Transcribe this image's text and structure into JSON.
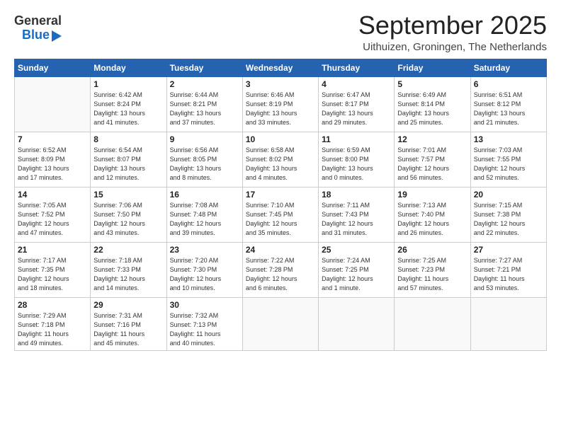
{
  "header": {
    "logo_general": "General",
    "logo_blue": "Blue",
    "month_title": "September 2025",
    "subtitle": "Uithuizen, Groningen, The Netherlands"
  },
  "weekdays": [
    "Sunday",
    "Monday",
    "Tuesday",
    "Wednesday",
    "Thursday",
    "Friday",
    "Saturday"
  ],
  "weeks": [
    [
      {
        "day": "",
        "info": ""
      },
      {
        "day": "1",
        "info": "Sunrise: 6:42 AM\nSunset: 8:24 PM\nDaylight: 13 hours\nand 41 minutes."
      },
      {
        "day": "2",
        "info": "Sunrise: 6:44 AM\nSunset: 8:21 PM\nDaylight: 13 hours\nand 37 minutes."
      },
      {
        "day": "3",
        "info": "Sunrise: 6:46 AM\nSunset: 8:19 PM\nDaylight: 13 hours\nand 33 minutes."
      },
      {
        "day": "4",
        "info": "Sunrise: 6:47 AM\nSunset: 8:17 PM\nDaylight: 13 hours\nand 29 minutes."
      },
      {
        "day": "5",
        "info": "Sunrise: 6:49 AM\nSunset: 8:14 PM\nDaylight: 13 hours\nand 25 minutes."
      },
      {
        "day": "6",
        "info": "Sunrise: 6:51 AM\nSunset: 8:12 PM\nDaylight: 13 hours\nand 21 minutes."
      }
    ],
    [
      {
        "day": "7",
        "info": "Sunrise: 6:52 AM\nSunset: 8:09 PM\nDaylight: 13 hours\nand 17 minutes."
      },
      {
        "day": "8",
        "info": "Sunrise: 6:54 AM\nSunset: 8:07 PM\nDaylight: 13 hours\nand 12 minutes."
      },
      {
        "day": "9",
        "info": "Sunrise: 6:56 AM\nSunset: 8:05 PM\nDaylight: 13 hours\nand 8 minutes."
      },
      {
        "day": "10",
        "info": "Sunrise: 6:58 AM\nSunset: 8:02 PM\nDaylight: 13 hours\nand 4 minutes."
      },
      {
        "day": "11",
        "info": "Sunrise: 6:59 AM\nSunset: 8:00 PM\nDaylight: 13 hours\nand 0 minutes."
      },
      {
        "day": "12",
        "info": "Sunrise: 7:01 AM\nSunset: 7:57 PM\nDaylight: 12 hours\nand 56 minutes."
      },
      {
        "day": "13",
        "info": "Sunrise: 7:03 AM\nSunset: 7:55 PM\nDaylight: 12 hours\nand 52 minutes."
      }
    ],
    [
      {
        "day": "14",
        "info": "Sunrise: 7:05 AM\nSunset: 7:52 PM\nDaylight: 12 hours\nand 47 minutes."
      },
      {
        "day": "15",
        "info": "Sunrise: 7:06 AM\nSunset: 7:50 PM\nDaylight: 12 hours\nand 43 minutes."
      },
      {
        "day": "16",
        "info": "Sunrise: 7:08 AM\nSunset: 7:48 PM\nDaylight: 12 hours\nand 39 minutes."
      },
      {
        "day": "17",
        "info": "Sunrise: 7:10 AM\nSunset: 7:45 PM\nDaylight: 12 hours\nand 35 minutes."
      },
      {
        "day": "18",
        "info": "Sunrise: 7:11 AM\nSunset: 7:43 PM\nDaylight: 12 hours\nand 31 minutes."
      },
      {
        "day": "19",
        "info": "Sunrise: 7:13 AM\nSunset: 7:40 PM\nDaylight: 12 hours\nand 26 minutes."
      },
      {
        "day": "20",
        "info": "Sunrise: 7:15 AM\nSunset: 7:38 PM\nDaylight: 12 hours\nand 22 minutes."
      }
    ],
    [
      {
        "day": "21",
        "info": "Sunrise: 7:17 AM\nSunset: 7:35 PM\nDaylight: 12 hours\nand 18 minutes."
      },
      {
        "day": "22",
        "info": "Sunrise: 7:18 AM\nSunset: 7:33 PM\nDaylight: 12 hours\nand 14 minutes."
      },
      {
        "day": "23",
        "info": "Sunrise: 7:20 AM\nSunset: 7:30 PM\nDaylight: 12 hours\nand 10 minutes."
      },
      {
        "day": "24",
        "info": "Sunrise: 7:22 AM\nSunset: 7:28 PM\nDaylight: 12 hours\nand 6 minutes."
      },
      {
        "day": "25",
        "info": "Sunrise: 7:24 AM\nSunset: 7:25 PM\nDaylight: 12 hours\nand 1 minute."
      },
      {
        "day": "26",
        "info": "Sunrise: 7:25 AM\nSunset: 7:23 PM\nDaylight: 11 hours\nand 57 minutes."
      },
      {
        "day": "27",
        "info": "Sunrise: 7:27 AM\nSunset: 7:21 PM\nDaylight: 11 hours\nand 53 minutes."
      }
    ],
    [
      {
        "day": "28",
        "info": "Sunrise: 7:29 AM\nSunset: 7:18 PM\nDaylight: 11 hours\nand 49 minutes."
      },
      {
        "day": "29",
        "info": "Sunrise: 7:31 AM\nSunset: 7:16 PM\nDaylight: 11 hours\nand 45 minutes."
      },
      {
        "day": "30",
        "info": "Sunrise: 7:32 AM\nSunset: 7:13 PM\nDaylight: 11 hours\nand 40 minutes."
      },
      {
        "day": "",
        "info": ""
      },
      {
        "day": "",
        "info": ""
      },
      {
        "day": "",
        "info": ""
      },
      {
        "day": "",
        "info": ""
      }
    ]
  ]
}
